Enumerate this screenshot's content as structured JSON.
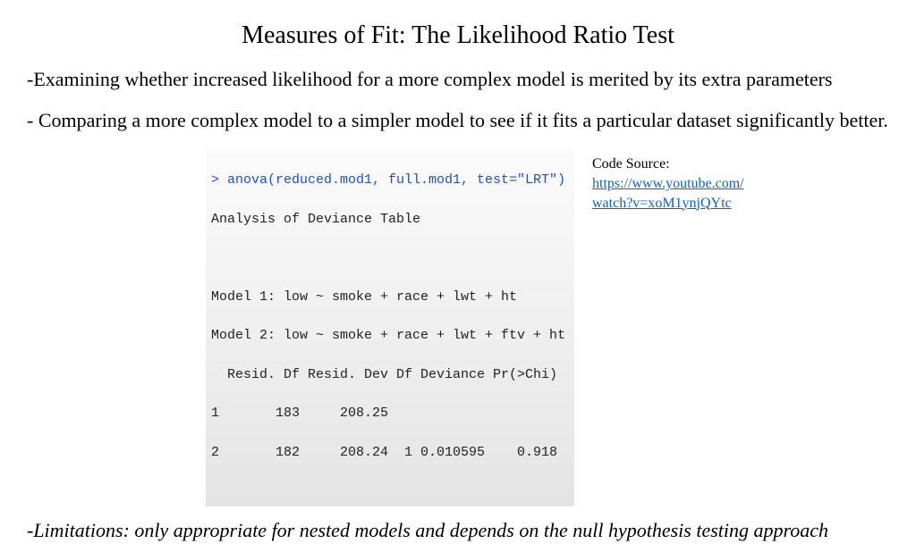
{
  "title": "Measures of Fit: The Likelihood Ratio Test",
  "bullets": {
    "b1": "-Examining whether increased likelihood for a more complex model is merited by its extra parameters",
    "b2": "- Comparing a more complex model to a simpler model to see if it fits a particular dataset significantly better.",
    "b3": "-Limitations: only appropriate for nested models and depends on the null hypothesis testing approach"
  },
  "code": {
    "prompt": "> anova(reduced.mod1, full.mod1, test=\"LRT\")",
    "header": "Analysis of Deviance Table",
    "blank": " ",
    "model1": "Model 1: low ~ smoke + race + lwt + ht",
    "model2": "Model 2: low ~ smoke + race + lwt + ftv + ht",
    "cols": "  Resid. Df Resid. Dev Df Deviance Pr(>Chi)",
    "row1": "1       183     208.25",
    "row2": "2       182     208.24  1 0.010595    0.918"
  },
  "source": {
    "label": "Code Source:",
    "url": "https://www.youtube.com/watch?v=xoM1ynjQYtc"
  }
}
